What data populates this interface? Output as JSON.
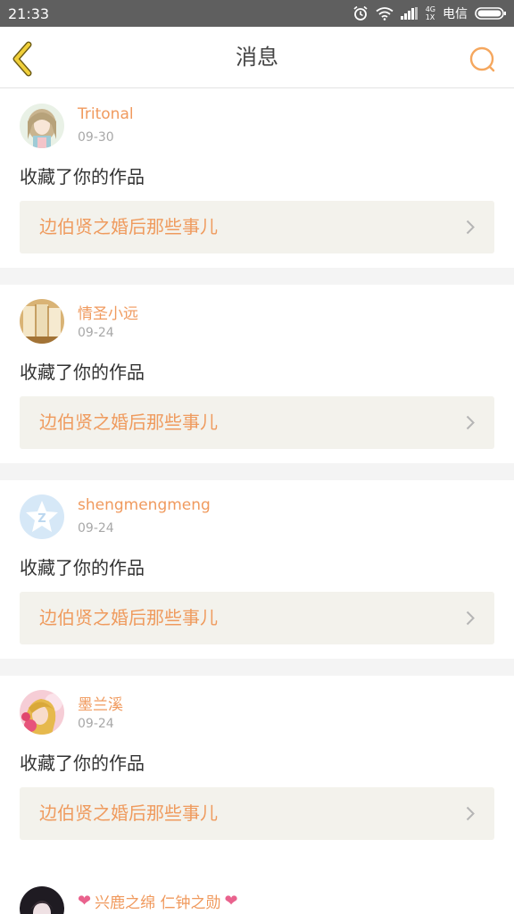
{
  "status_bar": {
    "time": "21:33",
    "network": "4G",
    "network_sub": "1X",
    "carrier": "电信",
    "icons": [
      "alarm-icon",
      "wifi-icon",
      "signal-icon",
      "battery-icon"
    ]
  },
  "nav": {
    "title": "消息",
    "back_icon": "back-chevron-icon",
    "search_icon": "search-icon",
    "accent_color": "#f5a75e"
  },
  "messages": [
    {
      "username": "Tritonal",
      "date": "09-30",
      "action": "收藏了你的作品",
      "work_title": "边伯贤之婚后那些事儿",
      "avatar": "anime-girl-avatar"
    },
    {
      "username": "情圣小远",
      "date": "09-24",
      "action": "收藏了你的作品",
      "work_title": "边伯贤之婚后那些事儿",
      "avatar": "books-avatar"
    },
    {
      "username": "shengmengmeng",
      "date": "09-24",
      "action": "收藏了你的作品",
      "work_title": "边伯贤之婚后那些事儿",
      "avatar": "default-z-avatar"
    },
    {
      "username": "墨兰溪",
      "date": "09-24",
      "action": "收藏了你的作品",
      "work_title": "边伯贤之婚后那些事儿",
      "avatar": "blonde-girl-avatar"
    }
  ],
  "partial_message": {
    "username": "兴鹿之绵 仁钟之勋",
    "avatar": "dark-avatar"
  },
  "colors": {
    "username": "#f09a5e",
    "work_title": "#ef9b5e",
    "work_bg": "#f3f2ec",
    "separator": "#f4f4f4",
    "heart": "#e9628d"
  }
}
